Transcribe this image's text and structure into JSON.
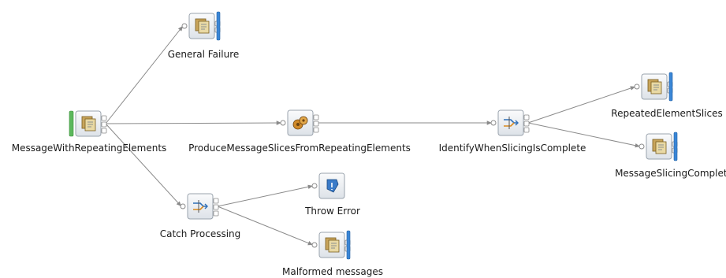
{
  "flow": {
    "nodes": {
      "input": {
        "label": "MessageWithRepeatingElements",
        "type": "input"
      },
      "general_failure": {
        "label": "General Failure",
        "type": "output"
      },
      "produce": {
        "label": "ProduceMessageSlicesFromRepeatingElements",
        "type": "compute"
      },
      "identify": {
        "label": "IdentifyWhenSlicingIsComplete",
        "type": "route"
      },
      "repeated": {
        "label": "RepeatedElementSlices",
        "type": "output"
      },
      "complete": {
        "label": "MessageSlicingComplete",
        "type": "output"
      },
      "catch": {
        "label": "Catch Processing",
        "type": "route"
      },
      "throw": {
        "label": "Throw Error",
        "type": "throw"
      },
      "malformed": {
        "label": "Malformed messages",
        "type": "output"
      }
    },
    "connections": [
      [
        "input",
        "general_failure"
      ],
      [
        "input",
        "produce"
      ],
      [
        "input",
        "catch"
      ],
      [
        "produce",
        "identify"
      ],
      [
        "identify",
        "repeated"
      ],
      [
        "identify",
        "complete"
      ],
      [
        "catch",
        "throw"
      ],
      [
        "catch",
        "malformed"
      ]
    ],
    "colors": {
      "connector": "#8a8a8a",
      "output_bar": "#3a86d6",
      "input_bar": "#5cb85c",
      "node_bg": "#eef1f5",
      "node_border": "#9aa3ad"
    }
  }
}
